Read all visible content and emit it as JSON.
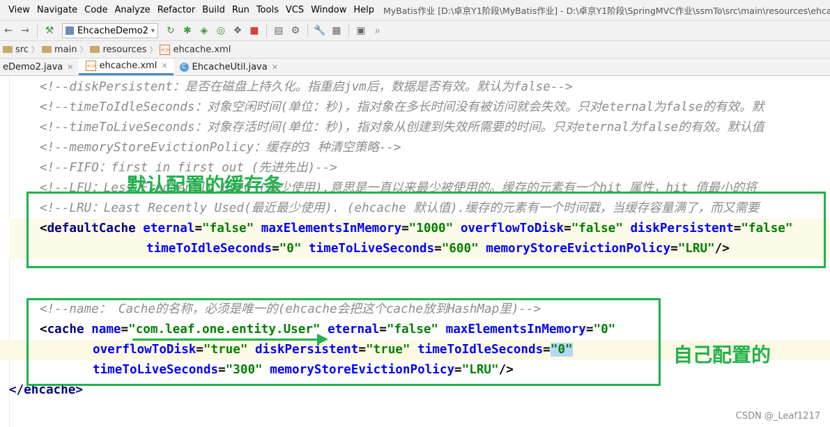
{
  "menu": {
    "items": [
      "View",
      "Navigate",
      "Code",
      "Analyze",
      "Refactor",
      "Build",
      "Run",
      "Tools",
      "VCS",
      "Window",
      "Help"
    ],
    "title": "MyBatis作业 [D:\\卓京Y1阶段\\MyBatis作业] - D:\\卓京Y1阶段\\SpringMVC作业\\ssmTo\\src\\main\\resources\\ehcache.xml"
  },
  "toolbar": {
    "run_config": "EhcacheDemo2"
  },
  "breadcrumb": [
    "src",
    "main",
    "resources",
    "ehcache.xml"
  ],
  "tabs": [
    {
      "label": "eDemo2.java"
    },
    {
      "label": "ehcache.xml"
    },
    {
      "label": "EhcacheUtil.java"
    }
  ],
  "code": {
    "c1": "<!--diskPersistent：是否在磁盘上持久化。指重启jvm后，数据是否有效。默认为false-->",
    "c2": "<!--timeToIdleSeconds：对象空闲时间(单位：秒)，指对象在多长时间没有被访问就会失效。只对eternal为false的有效。默",
    "c3": "<!--timeToLiveSeconds：对象存活时间(单位：秒)，指对象从创建到失效所需要的时间。只对eternal为false的有效。默认值",
    "c4": "<!--memoryStoreEvictionPolicy：缓存的3 种清空策略-->",
    "c5": "<!--FIFO：first in first out (先进先出)-->",
    "c6": "<!--LFU：Less Frequently Used (最少使用).意思是一直以来最少被使用的。缓存的元素有一个hit 属性，hit 值最小的将",
    "c7": "<!--LRU：Least Recently Used(最近最少使用). (ehcache 默认值).缓存的元素有一个时间戳，当缓存容量满了，而又需要",
    "c8": "<!--name： Cache的名称，必须是唯一的(ehcache会把这个cache放到HashMap里)-->",
    "default_tag": "defaultCache",
    "cache_tag": "cache",
    "close_tag": "</ehcache>",
    "attrs": {
      "eternal": "eternal",
      "eternal_false": "\"false\"",
      "maxElementsInMemory": "maxElementsInMemory",
      "max_1000": "\"1000\"",
      "max_0": "\"0\"",
      "overflowToDisk": "overflowToDisk",
      "ovf_false": "\"false\"",
      "ovf_true": "\"true\"",
      "diskPersistent": "diskPersistent",
      "dp_false": "\"false\"",
      "dp_true": "\"true\"",
      "timeToIdleSeconds": "timeToIdleSeconds",
      "tti_0": "\"0\"",
      "timeToLiveSeconds": "timeToLiveSeconds",
      "ttl_600": "\"600\"",
      "ttl_300": "\"300\"",
      "memoryStoreEvictionPolicy": "memoryStoreEvictionPolicy",
      "lru": "\"LRU\"",
      "name": "name",
      "name_val": "\"com.leaf.one.entity.User\""
    }
  },
  "annotations": {
    "default_label": "默认配置的缓存条",
    "custom_label": "自己配置的",
    "watermark": "CSDN @_Leaf1217"
  }
}
